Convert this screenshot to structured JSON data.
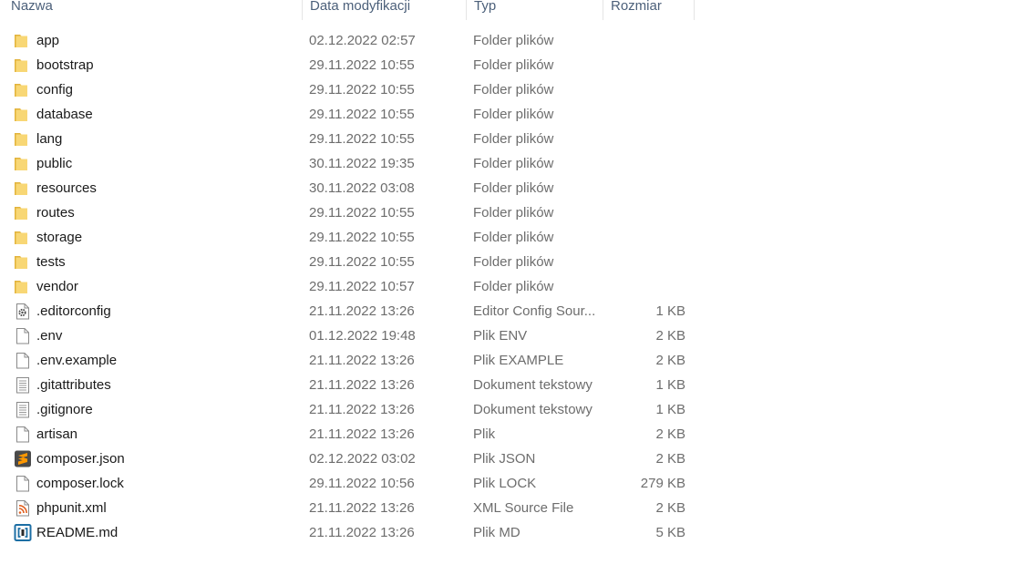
{
  "columns": {
    "name": "Nazwa",
    "date": "Data modyfikacji",
    "type": "Typ",
    "size": "Rozmiar"
  },
  "files": [
    {
      "name": "app",
      "date": "02.12.2022 02:57",
      "type": "Folder plików",
      "size": "",
      "icon": "folder-icon"
    },
    {
      "name": "bootstrap",
      "date": "29.11.2022 10:55",
      "type": "Folder plików",
      "size": "",
      "icon": "folder-icon"
    },
    {
      "name": "config",
      "date": "29.11.2022 10:55",
      "type": "Folder plików",
      "size": "",
      "icon": "folder-icon"
    },
    {
      "name": "database",
      "date": "29.11.2022 10:55",
      "type": "Folder plików",
      "size": "",
      "icon": "folder-icon"
    },
    {
      "name": "lang",
      "date": "29.11.2022 10:55",
      "type": "Folder plików",
      "size": "",
      "icon": "folder-icon"
    },
    {
      "name": "public",
      "date": "30.11.2022 19:35",
      "type": "Folder plików",
      "size": "",
      "icon": "folder-icon"
    },
    {
      "name": "resources",
      "date": "30.11.2022 03:08",
      "type": "Folder plików",
      "size": "",
      "icon": "folder-icon"
    },
    {
      "name": "routes",
      "date": "29.11.2022 10:55",
      "type": "Folder plików",
      "size": "",
      "icon": "folder-icon"
    },
    {
      "name": "storage",
      "date": "29.11.2022 10:55",
      "type": "Folder plików",
      "size": "",
      "icon": "folder-icon"
    },
    {
      "name": "tests",
      "date": "29.11.2022 10:55",
      "type": "Folder plików",
      "size": "",
      "icon": "folder-icon"
    },
    {
      "name": "vendor",
      "date": "29.11.2022 10:57",
      "type": "Folder plików",
      "size": "",
      "icon": "folder-icon"
    },
    {
      "name": ".editorconfig",
      "date": "21.11.2022 13:26",
      "type": "Editor Config Sour...",
      "size": "1 KB",
      "icon": "settings-file-icon"
    },
    {
      "name": ".env",
      "date": "01.12.2022 19:48",
      "type": "Plik ENV",
      "size": "2 KB",
      "icon": "blank-file-icon"
    },
    {
      "name": ".env.example",
      "date": "21.11.2022 13:26",
      "type": "Plik EXAMPLE",
      "size": "2 KB",
      "icon": "blank-file-icon"
    },
    {
      "name": ".gitattributes",
      "date": "21.11.2022 13:26",
      "type": "Dokument tekstowy",
      "size": "1 KB",
      "icon": "text-file-icon"
    },
    {
      "name": ".gitignore",
      "date": "21.11.2022 13:26",
      "type": "Dokument tekstowy",
      "size": "1 KB",
      "icon": "text-file-icon"
    },
    {
      "name": "artisan",
      "date": "21.11.2022 13:26",
      "type": "Plik",
      "size": "2 KB",
      "icon": "blank-file-icon"
    },
    {
      "name": "composer.json",
      "date": "02.12.2022 03:02",
      "type": "Plik JSON",
      "size": "2 KB",
      "icon": "sublime-text-icon"
    },
    {
      "name": "composer.lock",
      "date": "29.11.2022 10:56",
      "type": "Plik LOCK",
      "size": "279 KB",
      "icon": "blank-file-icon"
    },
    {
      "name": "phpunit.xml",
      "date": "21.11.2022 13:26",
      "type": "XML Source File",
      "size": "2 KB",
      "icon": "xml-file-icon"
    },
    {
      "name": "README.md",
      "date": "21.11.2022 13:26",
      "type": "Plik MD",
      "size": "5 KB",
      "icon": "markdown-file-icon"
    }
  ],
  "colors": {
    "header_text": "#4c607a",
    "folder": "#f8d775",
    "secondary_text": "#6d6d6d"
  }
}
